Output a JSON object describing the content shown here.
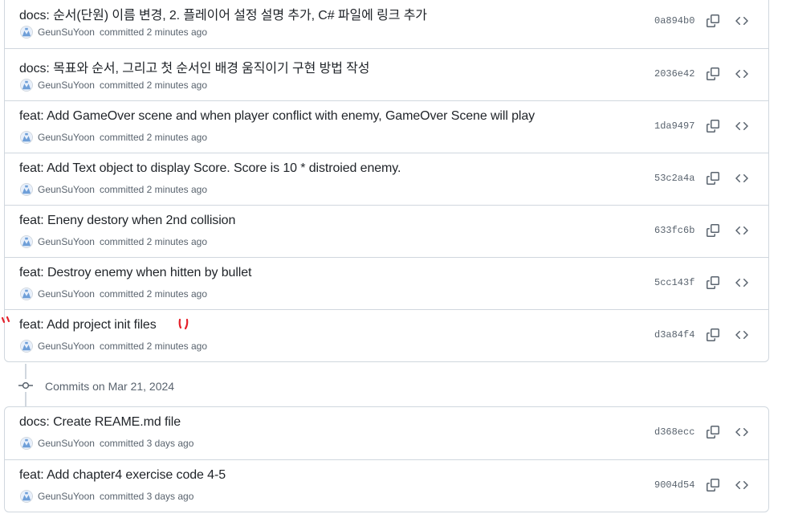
{
  "groups": [
    {
      "commits": [
        {
          "title": "docs: 순서(단원) 이름 변경, 2. 플레이어 설정 설명 추가, C# 파일에 링크 추가",
          "author": "GeunSuYoon",
          "committed": "committed 2 minutes ago",
          "sha": "0a894b0"
        },
        {
          "title": "docs: 목표와 순서, 그리고 첫 순서인 배경 움직이기 구현 방법 작성",
          "author": "GeunSuYoon",
          "committed": "committed 2 minutes ago",
          "sha": "2036e42"
        },
        {
          "title": "feat: Add GameOver scene and when player conflict with enemy, GameOver Scene will play",
          "author": "GeunSuYoon",
          "committed": "committed 2 minutes ago",
          "sha": "1da9497"
        },
        {
          "title": "feat: Add Text object to display Score. Score is 10 * distroied enemy.",
          "author": "GeunSuYoon",
          "committed": "committed 2 minutes ago",
          "sha": "53c2a4a"
        },
        {
          "title": "feat: Eneny destory when 2nd collision",
          "author": "GeunSuYoon",
          "committed": "committed 2 minutes ago",
          "sha": "633fc6b"
        },
        {
          "title": "feat: Destroy enemy when hitten by bullet",
          "author": "GeunSuYoon",
          "committed": "committed 2 minutes ago",
          "sha": "5cc143f"
        },
        {
          "title": "feat: Add project init files",
          "author": "GeunSuYoon",
          "committed": "committed 2 minutes ago",
          "sha": "d3a84f4"
        }
      ]
    },
    {
      "heading": "Commits on Mar 21, 2024",
      "commits": [
        {
          "title": "docs: Create REAME.md file",
          "author": "GeunSuYoon",
          "committed": "committed 3 days ago",
          "sha": "d368ecc"
        },
        {
          "title": "feat: Add chapter4 exercise code 4-5",
          "author": "GeunSuYoon",
          "committed": "committed 3 days ago",
          "sha": "9004d54"
        }
      ]
    }
  ],
  "icons": {
    "copy": "copy-icon",
    "browse": "code-icon",
    "timeline": "git-commit-icon"
  },
  "colors": {
    "border": "#d0d7de",
    "muted": "#59636e",
    "text": "#1f2328",
    "annotation": "#e5202a"
  }
}
